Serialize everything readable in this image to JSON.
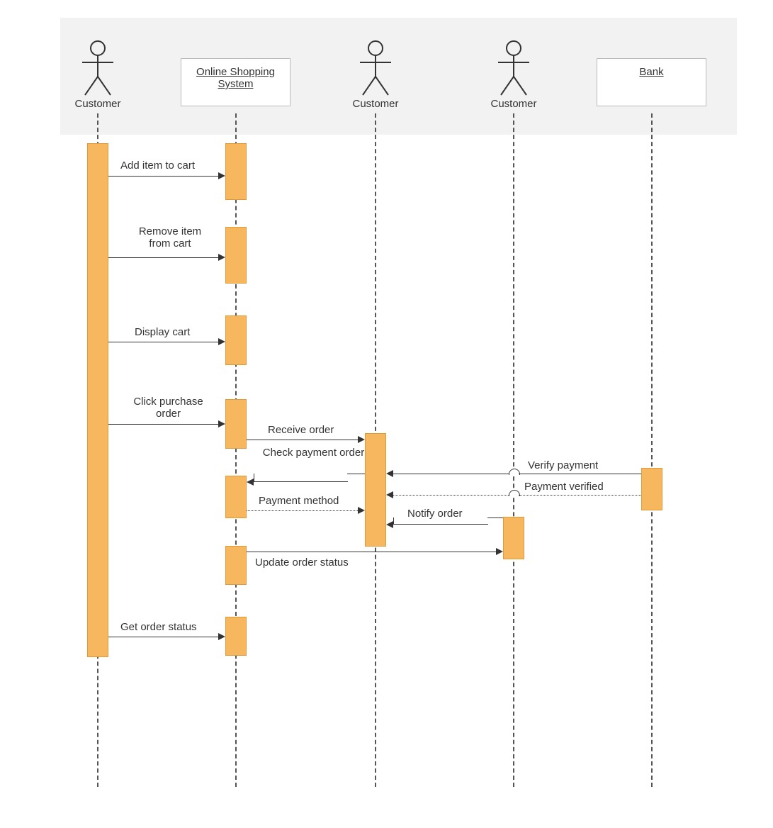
{
  "diagram_type": "sequence_diagram",
  "participants": {
    "p1": {
      "label": "Customer",
      "kind": "actor"
    },
    "p2": {
      "label": "Online Shopping System",
      "kind": "box"
    },
    "p3": {
      "label": "Customer",
      "kind": "actor"
    },
    "p4": {
      "label": "Customer",
      "kind": "actor"
    },
    "p5": {
      "label": "Bank",
      "kind": "box"
    }
  },
  "messages": {
    "m1": {
      "text": "Add item to cart",
      "from": "p1",
      "to": "p2",
      "style": "solid"
    },
    "m2": {
      "text": "Remove item from cart",
      "from": "p1",
      "to": "p2",
      "style": "solid"
    },
    "m3": {
      "text": "Display cart",
      "from": "p1",
      "to": "p2",
      "style": "solid"
    },
    "m4": {
      "text": "Click purchase order",
      "from": "p1",
      "to": "p2",
      "style": "solid"
    },
    "m5": {
      "text": "Receive order",
      "from": "p2",
      "to": "p3",
      "style": "solid"
    },
    "m6": {
      "text": "Check payment order",
      "from": "p3",
      "to": "p2",
      "style": "solid"
    },
    "m7": {
      "text": "Payment method",
      "from": "p2",
      "to": "p3",
      "style": "dotted"
    },
    "m8": {
      "text": "Verify payment",
      "from": "p5",
      "to": "p3",
      "style": "solid"
    },
    "m9": {
      "text": "Payment verified",
      "from": "p5",
      "to": "p3",
      "style": "dotted"
    },
    "m10": {
      "text": "Notify order",
      "from": "p4",
      "to": "p3",
      "style": "solid"
    },
    "m11": {
      "text": "Update order status",
      "from": "p2",
      "to": "p4",
      "style": "solid"
    },
    "m12": {
      "text": "Get order status",
      "from": "p1",
      "to": "p2",
      "style": "solid"
    }
  }
}
